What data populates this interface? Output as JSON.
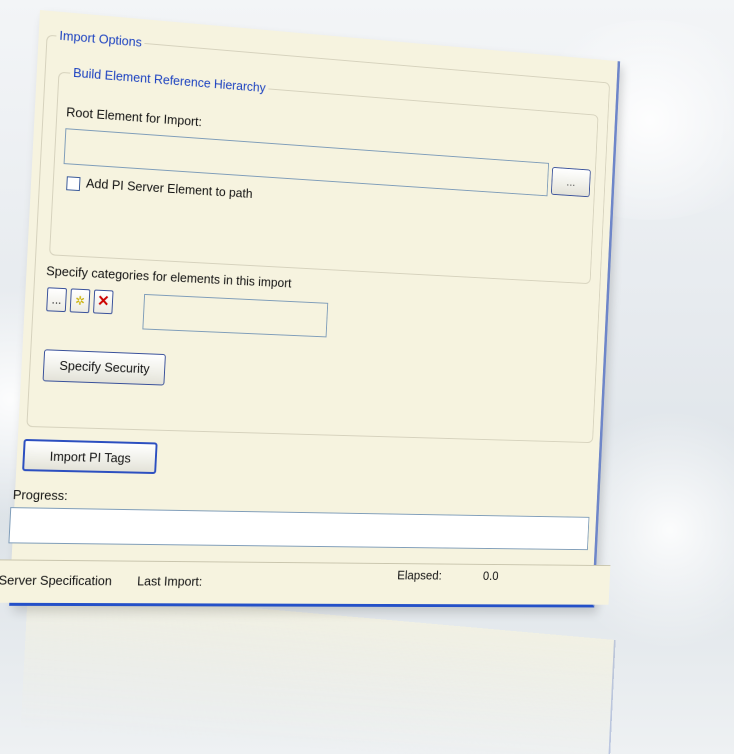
{
  "import_options": {
    "legend": "Import Options",
    "build_hierarchy": {
      "legend": "Build Element Reference Hierarchy",
      "root_label": "Root Element for Import:",
      "root_value": "",
      "browse_label": "...",
      "add_server_label": "Add PI Server Element to path",
      "add_server_checked": false
    },
    "categories": {
      "label": "Specify categories for elements in  this import",
      "tool_browse": "...",
      "tool_add": "✲",
      "tool_remove": "✕",
      "value": ""
    },
    "security_button": "Specify Security"
  },
  "import_button": "Import PI Tags",
  "progress": {
    "label": "Progress:",
    "value": 0
  },
  "status": {
    "server_spec_label": "Server Specification",
    "last_import_label": "Last Import:",
    "elapsed_label": "Elapsed:",
    "elapsed_value": "0.0"
  },
  "colors": {
    "window_bg": "#f6f3df",
    "legend_blue": "#1a40c0",
    "frame_blue": "#2450c8"
  }
}
